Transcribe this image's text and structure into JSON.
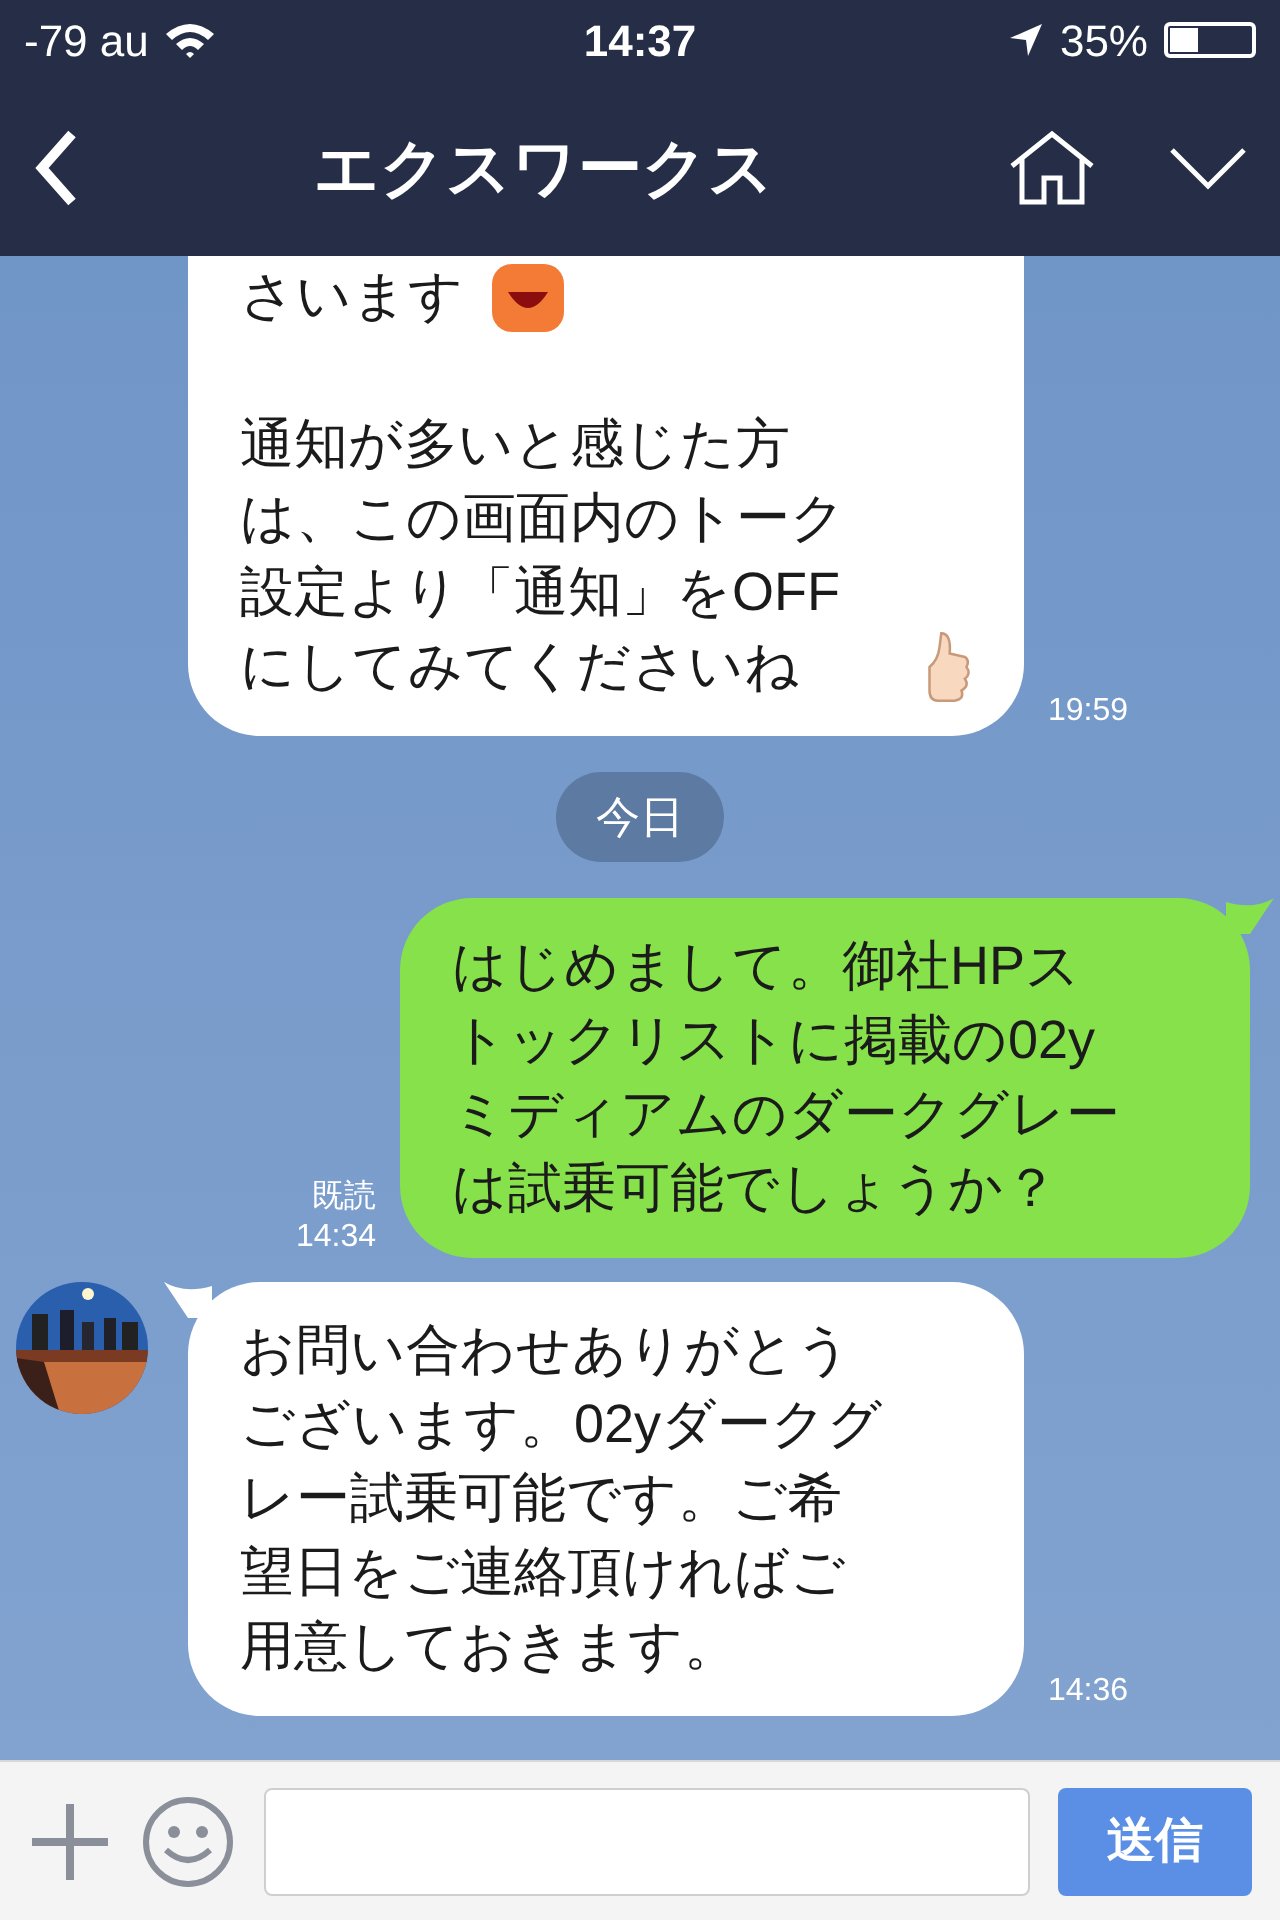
{
  "status_bar": {
    "carrier": "-79 au",
    "time": "14:37",
    "battery": "35%"
  },
  "header": {
    "title": "エクスワークス"
  },
  "messages": [
    {
      "kind": "incoming",
      "avatar": false,
      "paragraphs": [
        {
          "kind": "smile",
          "lines": [
            "さいます"
          ]
        },
        {
          "kind": "thumbs_up",
          "lines": [
            "通知が多いと感じた方",
            "は、この画面内のトーク",
            "設定より「通知」をOFF",
            "にしてみてくださいね"
          ]
        }
      ],
      "time": "19:59"
    },
    {
      "kind": "date",
      "text": "今日"
    },
    {
      "kind": "outgoing",
      "paragraphs": [
        {
          "kind": "plain",
          "lines": [
            "はじめまして。御社HPス",
            "トックリストに掲載の02y",
            "ミディアムのダークグレー",
            "は試乗可能でしょうか？"
          ]
        }
      ],
      "read": "既読",
      "time": "14:34"
    },
    {
      "kind": "incoming",
      "avatar": true,
      "paragraphs": [
        {
          "kind": "plain",
          "lines": [
            "お問い合わせありがとう",
            "ございます。02yダークグ",
            "レー試乗可能です。ご希",
            "望日をご連絡頂ければご",
            "用意しておきます。"
          ]
        }
      ],
      "time": "14:36"
    }
  ],
  "composer": {
    "send": "送信"
  }
}
